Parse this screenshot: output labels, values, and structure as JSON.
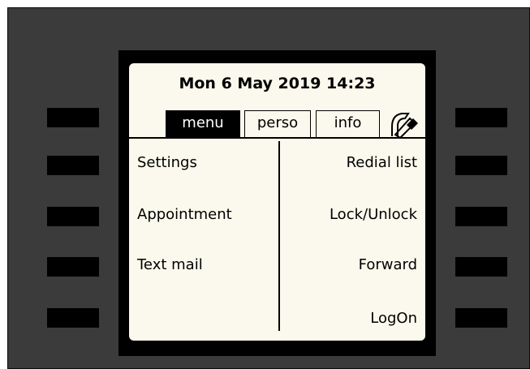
{
  "display": {
    "datetime": "Mon 6 May 2019 14:23"
  },
  "tabs": [
    {
      "label": "menu",
      "active": true
    },
    {
      "label": "perso",
      "active": false
    },
    {
      "label": "info",
      "active": false
    }
  ],
  "menu": {
    "left": [
      "Settings",
      "Appointment",
      "Text mail"
    ],
    "right": [
      "Redial list",
      "Lock/Unlock",
      "Forward",
      "LogOn"
    ]
  },
  "icons": {
    "tab_icon": "phone-handset-icon"
  },
  "colors": {
    "frame": "#3b3b3b",
    "screen": "#fbf9ed",
    "keys": "#000000"
  }
}
